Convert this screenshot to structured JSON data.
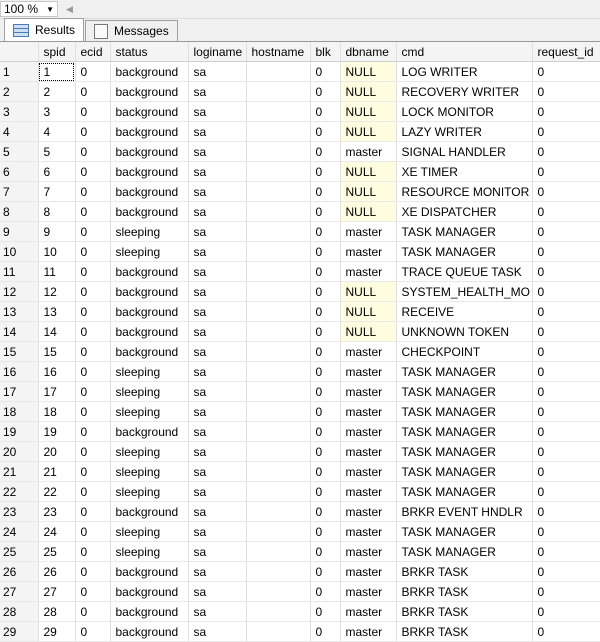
{
  "toolbar": {
    "zoom": "100 %"
  },
  "tabs": [
    {
      "label": "Results"
    },
    {
      "label": "Messages"
    }
  ],
  "columns": [
    "",
    "spid",
    "ecid",
    "status",
    "loginame",
    "hostname",
    "blk",
    "dbname",
    "cmd",
    "request_id"
  ],
  "rows": [
    [
      "1",
      "1",
      "0",
      "background",
      "sa",
      "",
      "0",
      "NULL",
      "LOG WRITER",
      "0"
    ],
    [
      "2",
      "2",
      "0",
      "background",
      "sa",
      "",
      "0",
      "NULL",
      "RECOVERY WRITER",
      "0"
    ],
    [
      "3",
      "3",
      "0",
      "background",
      "sa",
      "",
      "0",
      "NULL",
      "LOCK MONITOR",
      "0"
    ],
    [
      "4",
      "4",
      "0",
      "background",
      "sa",
      "",
      "0",
      "NULL",
      "LAZY WRITER",
      "0"
    ],
    [
      "5",
      "5",
      "0",
      "background",
      "sa",
      "",
      "0",
      "master",
      "SIGNAL HANDLER",
      "0"
    ],
    [
      "6",
      "6",
      "0",
      "background",
      "sa",
      "",
      "0",
      "NULL",
      "XE TIMER",
      "0"
    ],
    [
      "7",
      "7",
      "0",
      "background",
      "sa",
      "",
      "0",
      "NULL",
      "RESOURCE MONITOR",
      "0"
    ],
    [
      "8",
      "8",
      "0",
      "background",
      "sa",
      "",
      "0",
      "NULL",
      "XE DISPATCHER",
      "0"
    ],
    [
      "9",
      "9",
      "0",
      "sleeping",
      "sa",
      "",
      "0",
      "master",
      "TASK MANAGER",
      "0"
    ],
    [
      "10",
      "10",
      "0",
      "sleeping",
      "sa",
      "",
      "0",
      "master",
      "TASK MANAGER",
      "0"
    ],
    [
      "11",
      "11",
      "0",
      "background",
      "sa",
      "",
      "0",
      "master",
      "TRACE QUEUE TASK",
      "0"
    ],
    [
      "12",
      "12",
      "0",
      "background",
      "sa",
      "",
      "0",
      "NULL",
      "SYSTEM_HEALTH_MO",
      "0"
    ],
    [
      "13",
      "13",
      "0",
      "background",
      "sa",
      "",
      "0",
      "NULL",
      "RECEIVE",
      "0"
    ],
    [
      "14",
      "14",
      "0",
      "background",
      "sa",
      "",
      "0",
      "NULL",
      "UNKNOWN TOKEN",
      "0"
    ],
    [
      "15",
      "15",
      "0",
      "background",
      "sa",
      "",
      "0",
      "master",
      "CHECKPOINT",
      "0"
    ],
    [
      "16",
      "16",
      "0",
      "sleeping",
      "sa",
      "",
      "0",
      "master",
      "TASK MANAGER",
      "0"
    ],
    [
      "17",
      "17",
      "0",
      "sleeping",
      "sa",
      "",
      "0",
      "master",
      "TASK MANAGER",
      "0"
    ],
    [
      "18",
      "18",
      "0",
      "sleeping",
      "sa",
      "",
      "0",
      "master",
      "TASK MANAGER",
      "0"
    ],
    [
      "19",
      "19",
      "0",
      "background",
      "sa",
      "",
      "0",
      "master",
      "TASK MANAGER",
      "0"
    ],
    [
      "20",
      "20",
      "0",
      "sleeping",
      "sa",
      "",
      "0",
      "master",
      "TASK MANAGER",
      "0"
    ],
    [
      "21",
      "21",
      "0",
      "sleeping",
      "sa",
      "",
      "0",
      "master",
      "TASK MANAGER",
      "0"
    ],
    [
      "22",
      "22",
      "0",
      "sleeping",
      "sa",
      "",
      "0",
      "master",
      "TASK MANAGER",
      "0"
    ],
    [
      "23",
      "23",
      "0",
      "background",
      "sa",
      "",
      "0",
      "master",
      "BRKR EVENT HNDLR",
      "0"
    ],
    [
      "24",
      "24",
      "0",
      "sleeping",
      "sa",
      "",
      "0",
      "master",
      "TASK MANAGER",
      "0"
    ],
    [
      "25",
      "25",
      "0",
      "sleeping",
      "sa",
      "",
      "0",
      "master",
      "TASK MANAGER",
      "0"
    ],
    [
      "26",
      "26",
      "0",
      "background",
      "sa",
      "",
      "0",
      "master",
      "BRKR TASK",
      "0"
    ],
    [
      "27",
      "27",
      "0",
      "background",
      "sa",
      "",
      "0",
      "master",
      "BRKR TASK",
      "0"
    ],
    [
      "28",
      "28",
      "0",
      "background",
      "sa",
      "",
      "0",
      "master",
      "BRKR TASK",
      "0"
    ],
    [
      "29",
      "29",
      "0",
      "background",
      "sa",
      "",
      "0",
      "master",
      "BRKR TASK",
      "0"
    ]
  ]
}
